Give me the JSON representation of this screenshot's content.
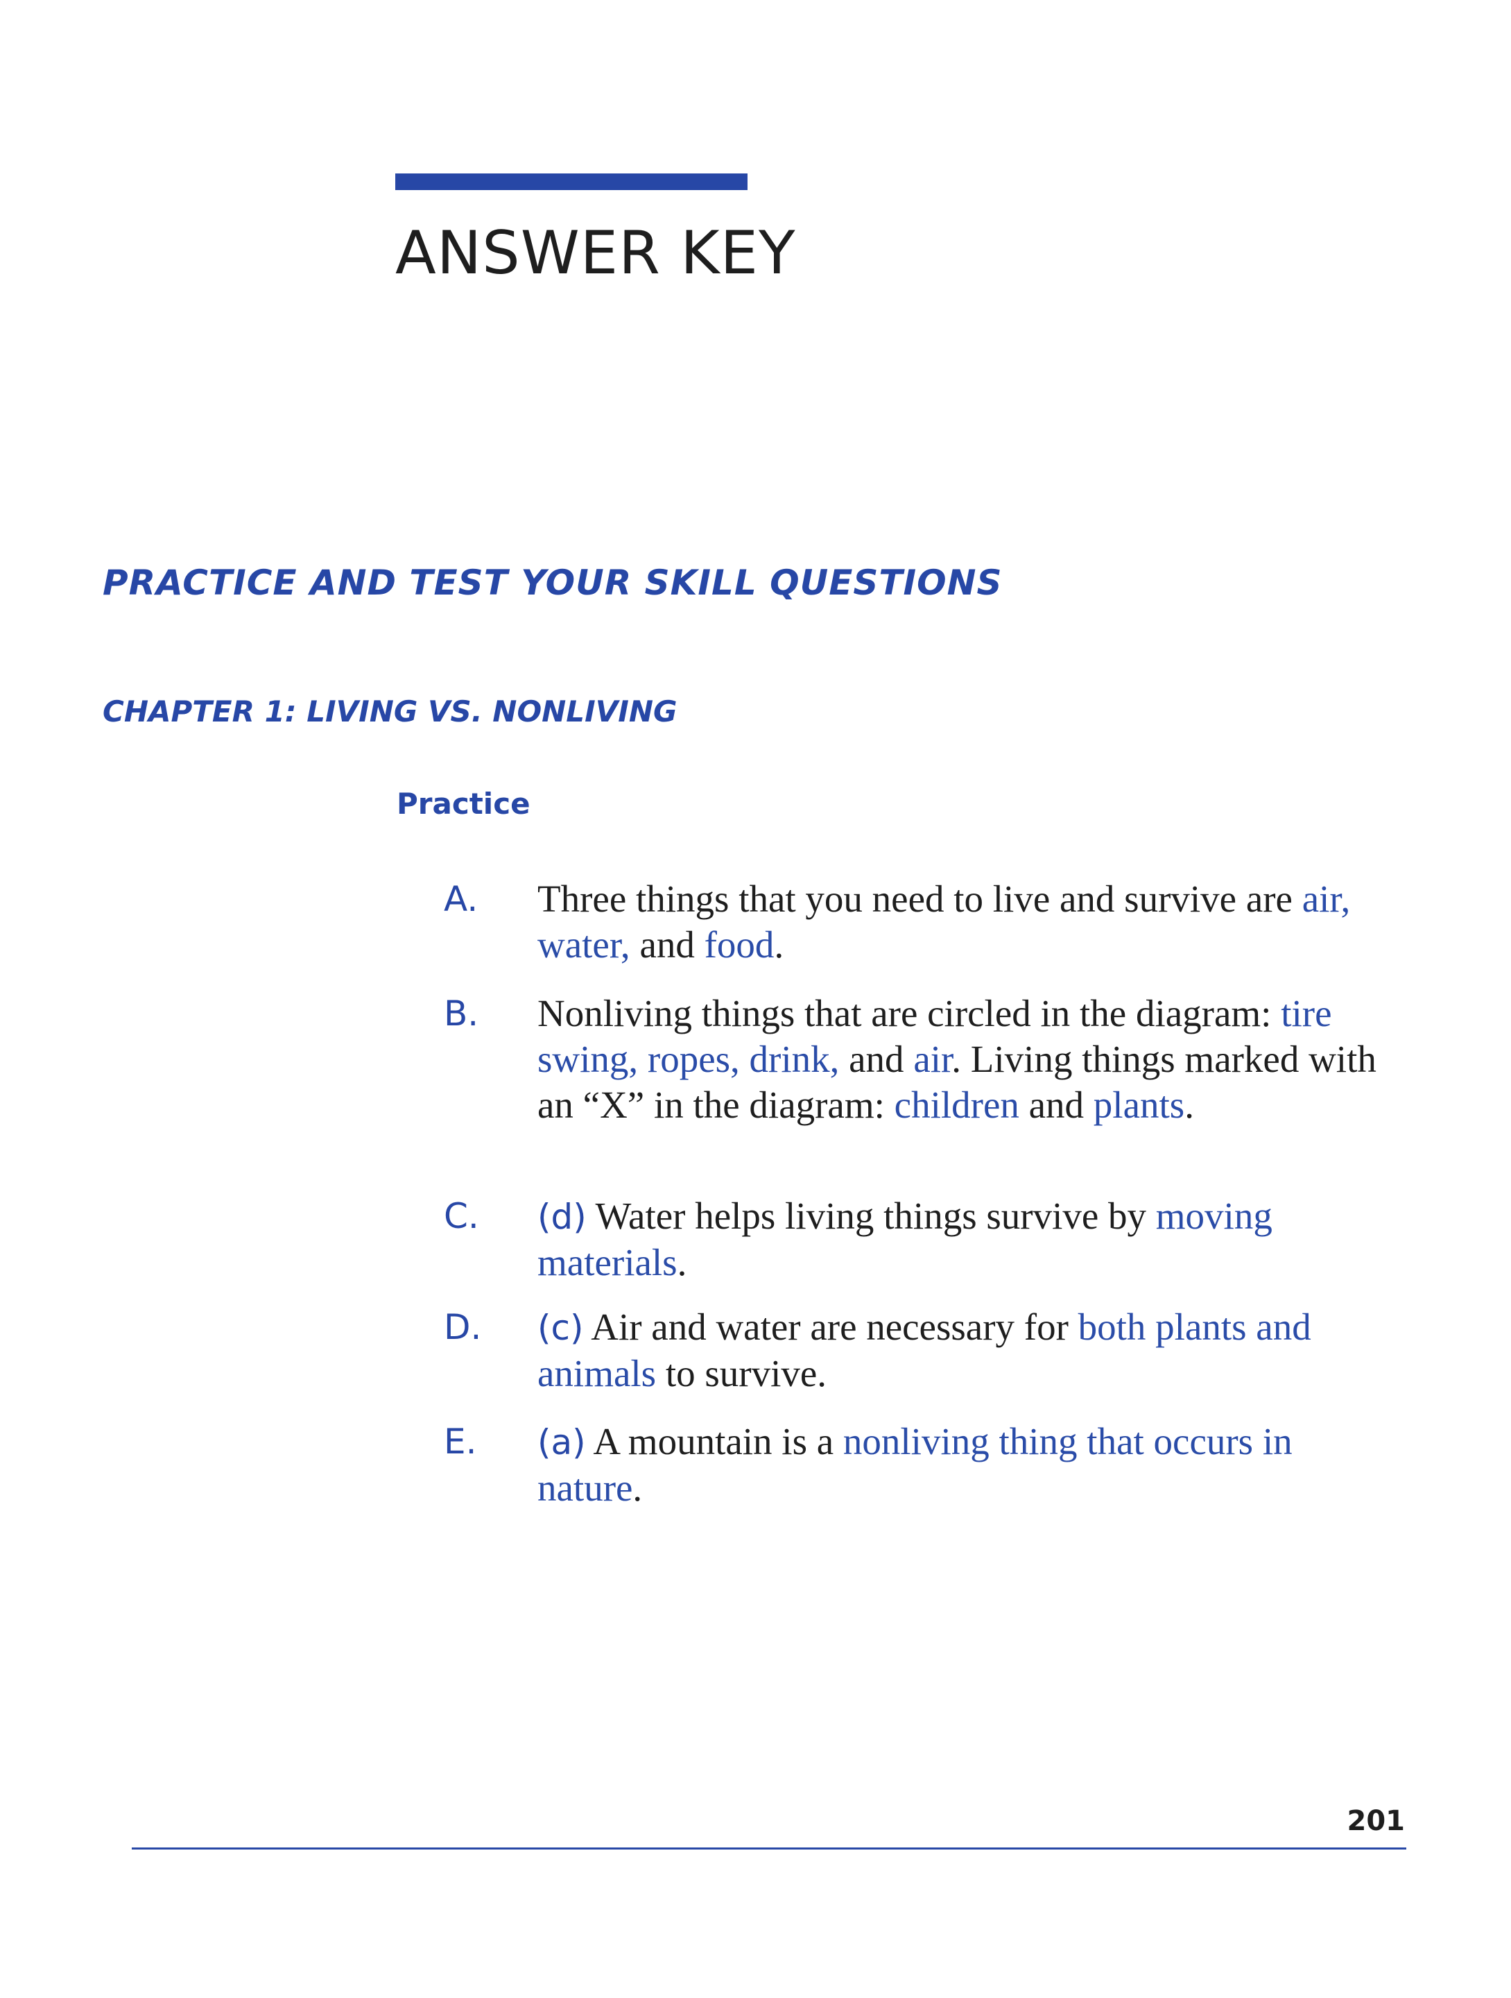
{
  "header": {
    "title": "ANSWER KEY"
  },
  "section_title": "PRACTICE AND TEST YOUR SKILL QUESTIONS",
  "chapter_title": "CHAPTER 1: LIVING VS. NONLIVING",
  "subsection_title": "Practice",
  "items": [
    {
      "letter": "A.",
      "parts": [
        "Three things that you need to live and survive are ",
        "air, water,",
        " and ",
        "food",
        "."
      ]
    },
    {
      "letter": "B.",
      "parts": [
        "Nonliving things that are circled in the diagram: ",
        "tire swing, ropes, drink,",
        " and ",
        "air",
        ". Living things marked with an “X” in the diagram: ",
        "children",
        " and ",
        "plants",
        "."
      ]
    },
    {
      "letter": "C.",
      "choice": "(d)",
      "parts": [
        " Water helps living things survive by ",
        "moving materials",
        "."
      ]
    },
    {
      "letter": "D.",
      "choice": "(c)",
      "parts": [
        " Air and water are necessary for ",
        "both plants and animals",
        " to survive."
      ]
    },
    {
      "letter": "E.",
      "choice": "(a)",
      "parts": [
        " A mountain is a ",
        "nonliving thing that occurs in nature",
        "."
      ]
    }
  ],
  "footer": {
    "page_number": "201"
  },
  "colors": {
    "accent": "#2747a6",
    "answer": "#2a4ca8",
    "text": "#1e1e1e"
  }
}
